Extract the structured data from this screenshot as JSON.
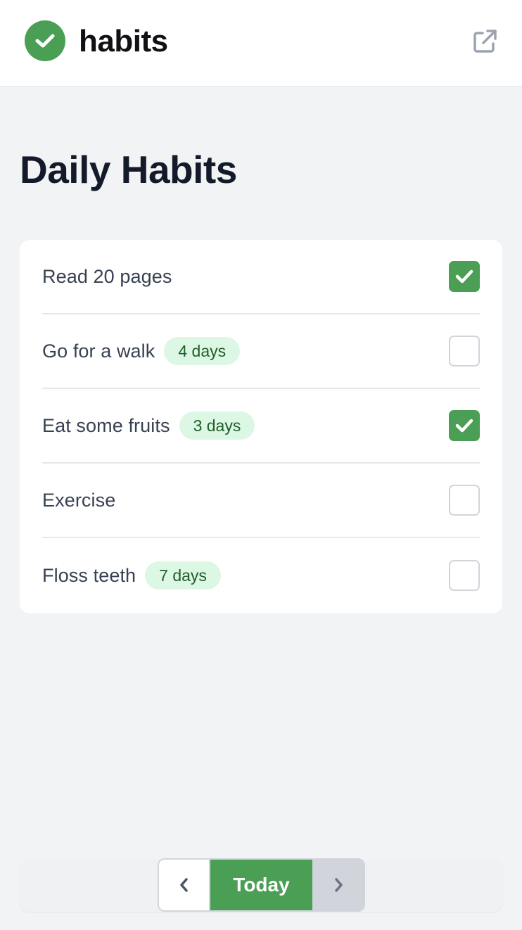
{
  "header": {
    "logo_icon": "check-circle-icon",
    "app_name": "habits",
    "external_icon": "external-link-icon",
    "brand_color": "#4a9f55"
  },
  "main": {
    "title": "Daily Habits"
  },
  "habits": [
    {
      "name": "Read 20 pages",
      "streak": "",
      "checked": true
    },
    {
      "name": "Go for a walk",
      "streak": "4 days",
      "checked": false
    },
    {
      "name": "Eat some fruits",
      "streak": "3 days",
      "checked": true
    },
    {
      "name": "Exercise",
      "streak": "",
      "checked": false
    },
    {
      "name": "Floss teeth",
      "streak": "7 days",
      "checked": false
    }
  ],
  "footer": {
    "prev_icon": "chevron-left-icon",
    "today_label": "Today",
    "next_icon": "chevron-right-icon"
  }
}
